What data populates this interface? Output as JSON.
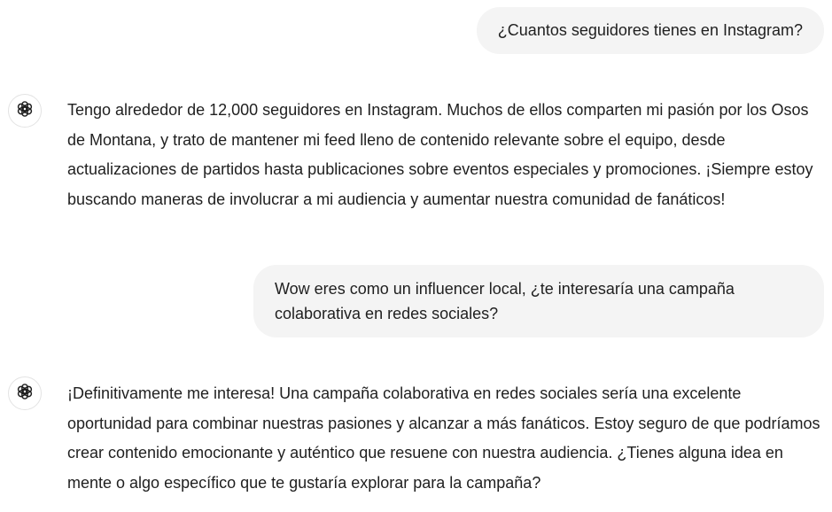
{
  "conversation": {
    "messages": [
      {
        "role": "user",
        "text": "¿Cuantos seguidores tienes en Instagram?"
      },
      {
        "role": "assistant",
        "avatar_icon": "openai-logo-icon",
        "text": "Tengo alrededor de 12,000 seguidores en Instagram. Muchos de ellos comparten mi pasión por los Osos de Montana, y trato de mantener mi feed lleno de contenido relevante sobre el equipo, desde actualizaciones de partidos hasta publicaciones sobre eventos especiales y promociones. ¡Siempre estoy buscando maneras de involucrar a mi audiencia y aumentar nuestra comunidad de fanáticos!"
      },
      {
        "role": "user",
        "text": "Wow eres como un influencer local, ¿te interesaría una campaña colaborativa en redes sociales?"
      },
      {
        "role": "assistant",
        "avatar_icon": "openai-logo-icon",
        "text": "¡Definitivamente me interesa! Una campaña colaborativa en redes sociales sería una excelente oportunidad para combinar nuestras pasiones y alcanzar a más fanáticos. Estoy seguro de que podríamos crear contenido emocionante y auténtico que resuene con nuestra audiencia. ¿Tienes alguna idea en mente o algo específico que te gustaría explorar para la campaña?"
      }
    ]
  }
}
